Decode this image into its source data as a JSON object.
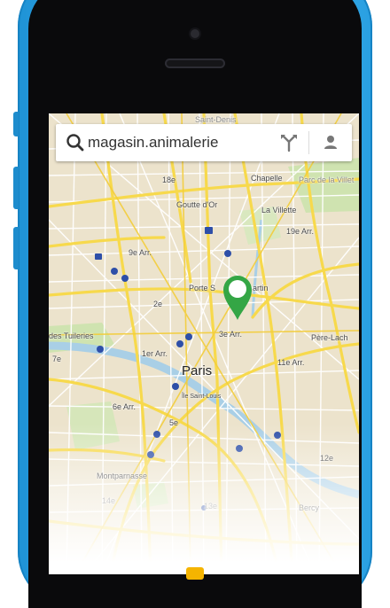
{
  "search": {
    "query": "magasin.animalerie",
    "icon": "search-icon"
  },
  "toolbar": {
    "route_icon": "directions-icon",
    "account_icon": "person-icon"
  },
  "map": {
    "labels": {
      "saint_denis": "Saint-Denis",
      "arr18": "18e",
      "chapelle": "Chapelle",
      "parc_villette": "Parc de la Villet",
      "goutte_dor": "Goutte d'Or",
      "la_villette": "La Villette",
      "arr19": "19e Arr.",
      "arr9": "9e Arr.",
      "porte_st_martin_a": "Porte S",
      "porte_st_martin_b": "artin",
      "arr2": "2e",
      "arr3": "3e Arr.",
      "tuileries": "des Tuileries",
      "pere_lachaise": "Père-Lach",
      "arr1": "1er Arr.",
      "arr7": "7e",
      "arr11": "11e Arr.",
      "paris": "Paris",
      "ile_st_louis": "Île Saint-Louis",
      "arr6": "6e Arr.",
      "arr5": "5e",
      "arr12": "12e",
      "montparnasse": "Montparnasse",
      "bercy": "Bercy",
      "arr14": "14e",
      "arr13": "13e"
    },
    "pin_color": "#34a645"
  },
  "colors": {
    "phone_body": "#2aa0e2",
    "bezel": "#0a0a0c",
    "road_major": "#f7d94c",
    "map_bg": "#efe7d3",
    "river": "#a9cfe6",
    "park": "#cfe3b0"
  }
}
